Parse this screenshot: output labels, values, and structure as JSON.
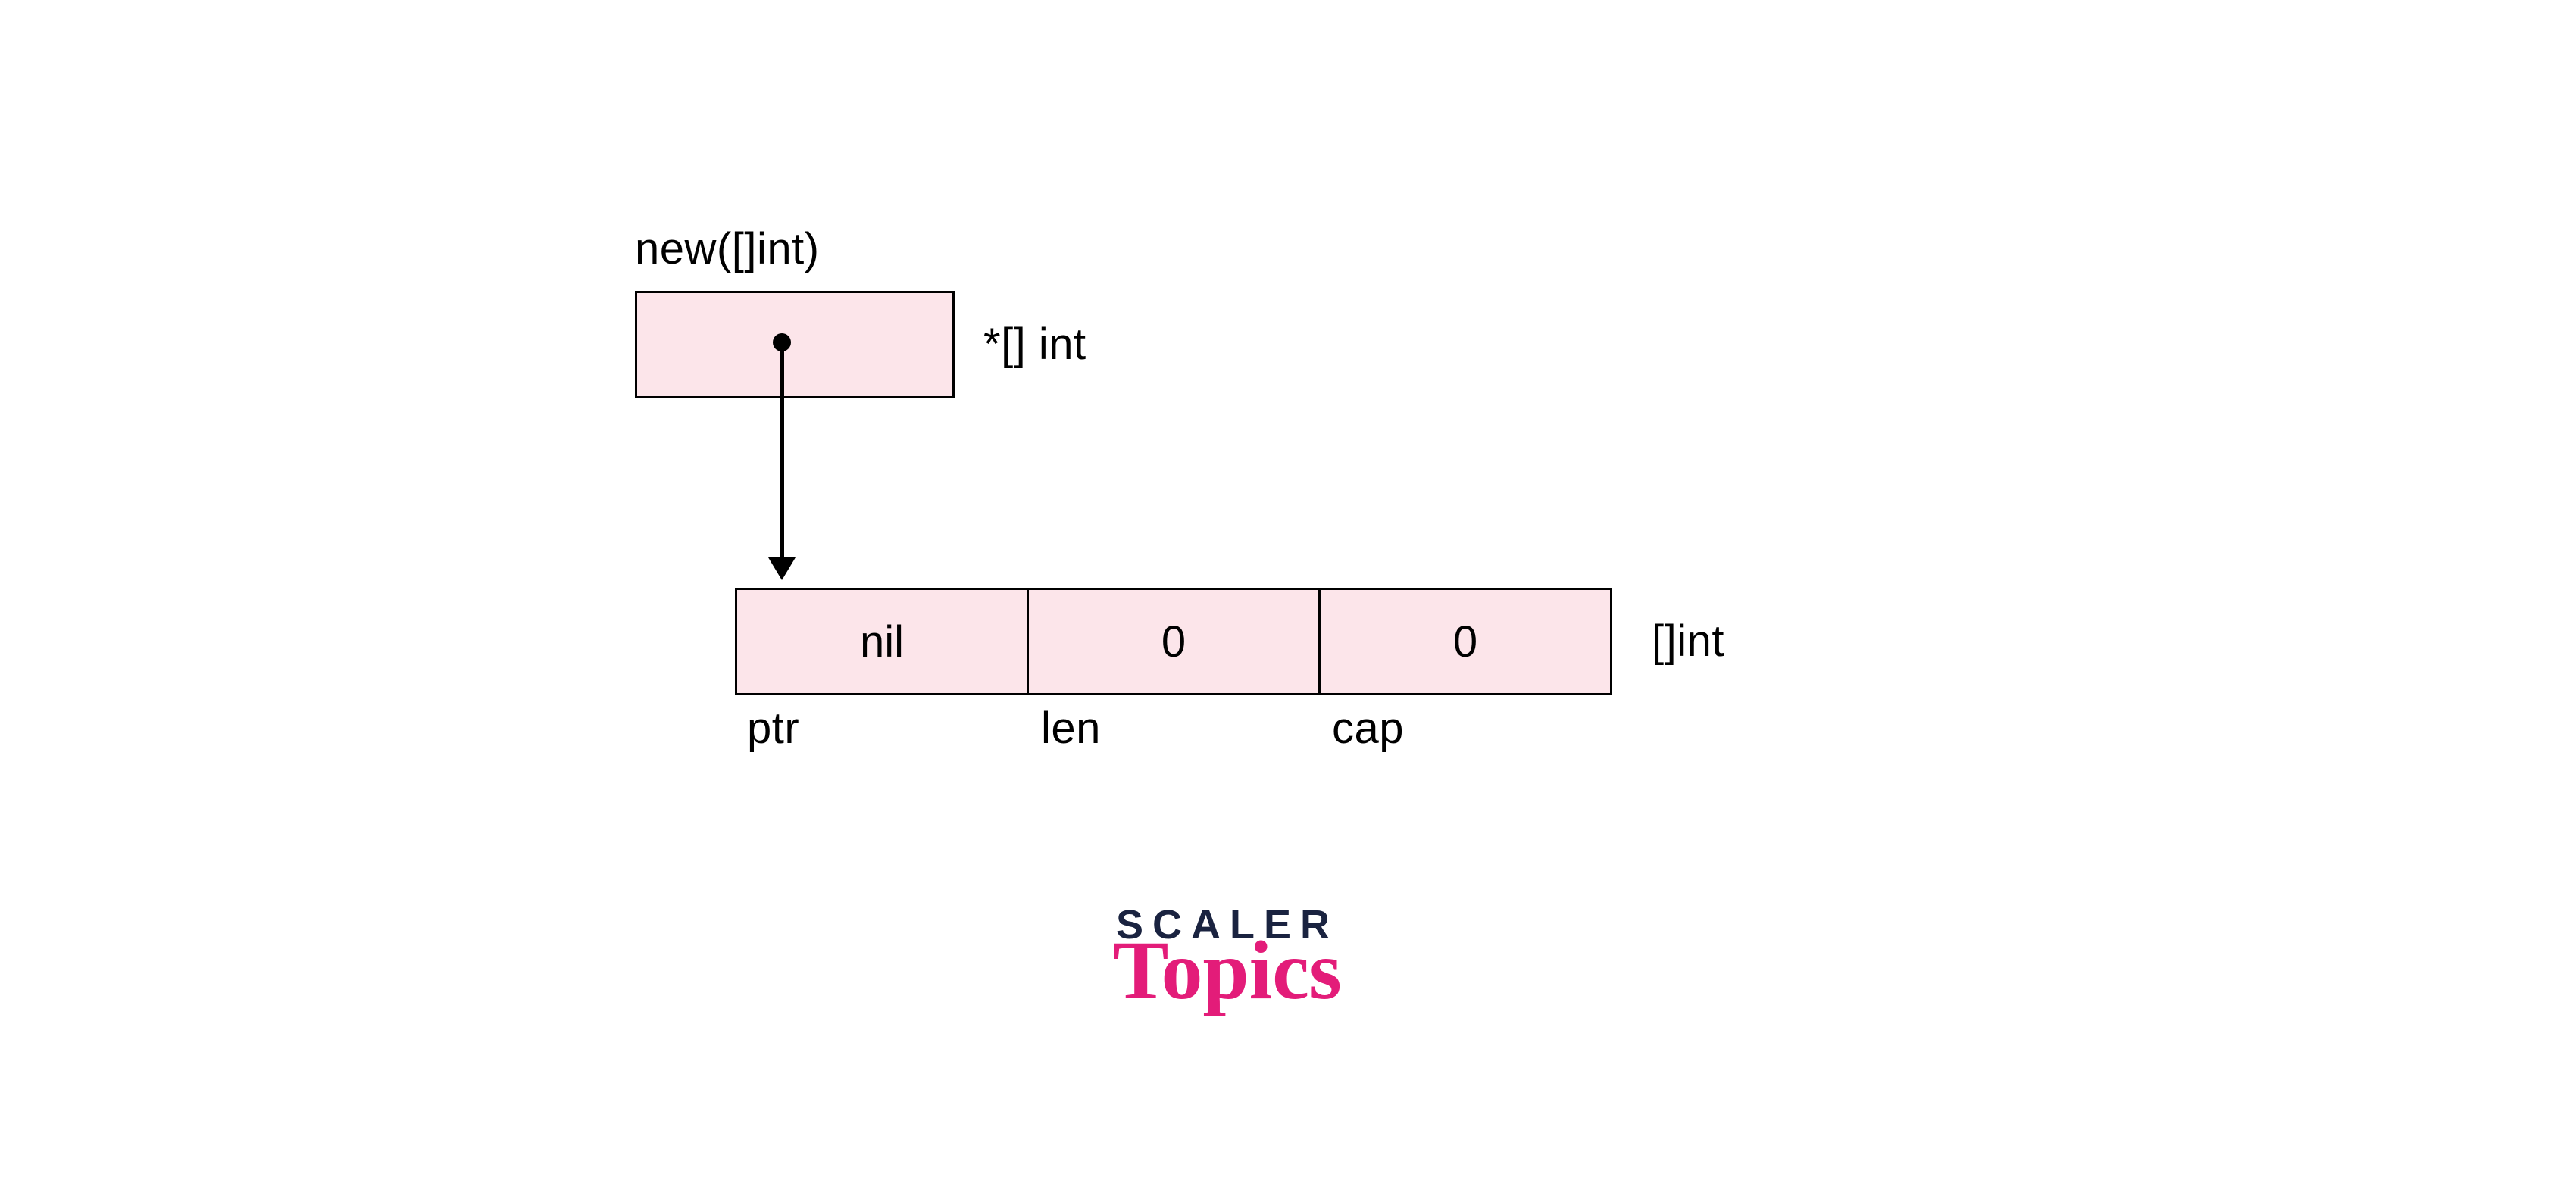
{
  "top": {
    "heading": "new([]int)",
    "type_label": "*[] int"
  },
  "slice": {
    "type_label": "[]int",
    "cells": [
      {
        "value": "nil",
        "field": "ptr"
      },
      {
        "value": "0",
        "field": "len"
      },
      {
        "value": "0",
        "field": "cap"
      }
    ]
  },
  "logo": {
    "line1": "SCALER",
    "line2": "Topics"
  }
}
